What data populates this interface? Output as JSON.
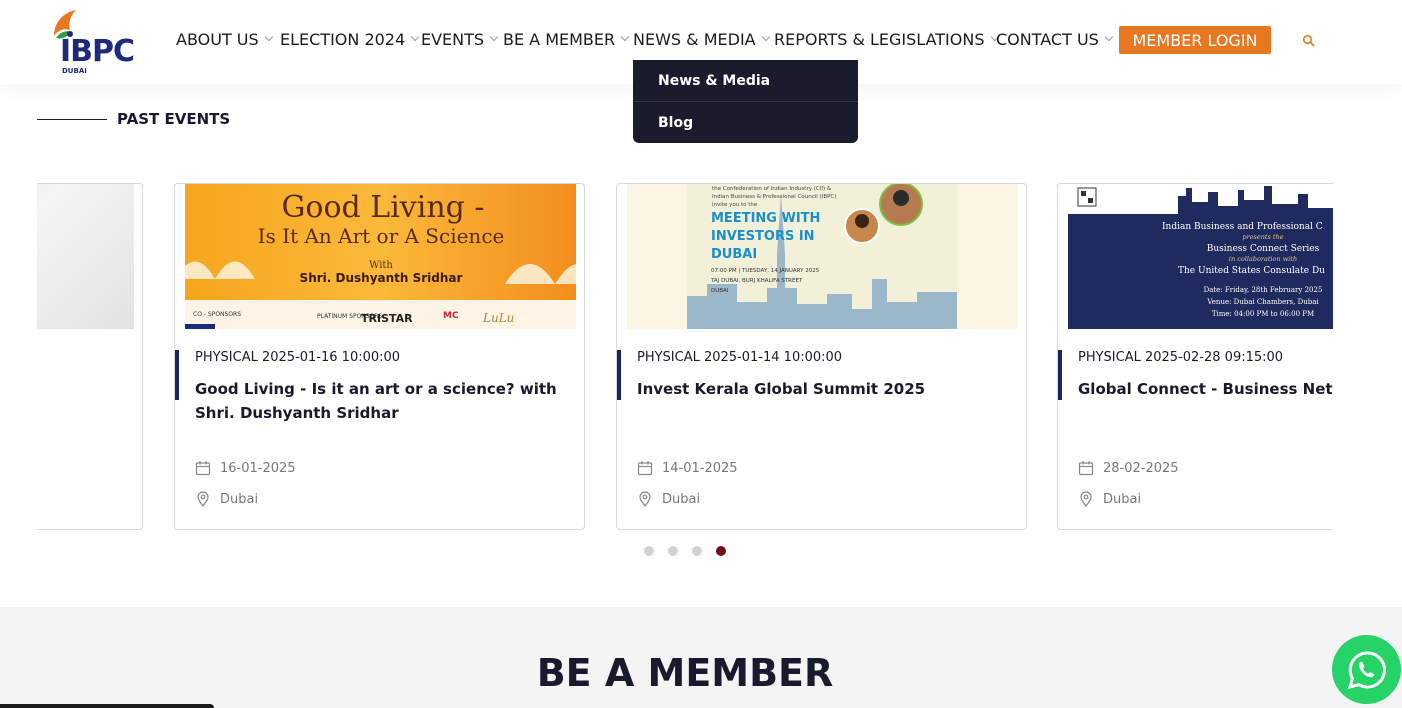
{
  "header": {
    "logo_text": "IBPC",
    "logo_city": "DUBAI",
    "nav": [
      {
        "label": "ABOUT US"
      },
      {
        "label": "ELECTION 2024"
      },
      {
        "label": "EVENTS"
      },
      {
        "label": "BE A MEMBER"
      },
      {
        "label": "NEWS & MEDIA"
      },
      {
        "label": "REPORTS & LEGISLATIONS"
      },
      {
        "label": "CONTACT US"
      }
    ],
    "login_label": "MEMBER LOGIN",
    "search_icon": "search-icon"
  },
  "dropdown": {
    "items": [
      {
        "label": "News & Media"
      },
      {
        "label": "Blog"
      }
    ]
  },
  "past_events": {
    "heading": "PAST EVENTS",
    "cards": [
      {
        "type": "PHYSICAL 2025-01-16 10:00:00",
        "title": "Good Living - Is it an art or a science? with Shri. Dushyanth Sridhar",
        "date": "16-01-2025",
        "location": "Dubai",
        "banner": {
          "line1": "Good Living -",
          "line2": "Is It An Art or A Science",
          "with": "With",
          "speaker": "Shri. Dushyanth Sridhar",
          "co_sponsors": "CO - SPONSORS",
          "platinum": "PLATINUM SPONSORS",
          "sponsor1": "TRISTAR",
          "sponsor2": "MC",
          "sponsor3": "LuLu"
        }
      },
      {
        "type": "PHYSICAL 2025-01-14 10:00:00",
        "title": "Invest Kerala Global Summit 2025",
        "date": "14-01-2025",
        "location": "Dubai",
        "banner": {
          "intro1": "the Confederation of Indian Industry (CII) &",
          "intro2": "Indian Business & Professional Council (IBPC)",
          "intro3": "invite you to the",
          "headline1": "MEETING WITH",
          "headline2": "INVESTORS IN",
          "headline3": "DUBAI",
          "when": "07:00 PM | TUESDAY, 14 JANUARY 2025",
          "where1": "TAJ DUBAI, BURJ KHALIFA STREET",
          "where2": "DUBAI"
        }
      },
      {
        "type": "PHYSICAL 2025-02-28 09:15:00",
        "title": "Global Connect - Business Netwo",
        "date": "28-02-2025",
        "location": "Dubai",
        "banner": {
          "l1": "Indian Business and Professional C",
          "l2": "presents the",
          "l3": "Business Connect Series",
          "l4": "in collaboration with",
          "l5": "The United States Consulate Du",
          "l6": "Date: Friday, 28th February 2025",
          "l7": "Venue: Dubai Chambers, Dubai",
          "l8": "Time: 04:00 PM to 06:00 PM"
        }
      }
    ],
    "dots_total": 4,
    "dots_active": 4
  },
  "member_section": {
    "heading": "BE A MEMBER"
  },
  "colors": {
    "accent": "#e87722",
    "navy": "#1e2260",
    "dark": "#1b1b2e",
    "dot_active": "#6b0f1f",
    "whatsapp": "#25d366"
  }
}
